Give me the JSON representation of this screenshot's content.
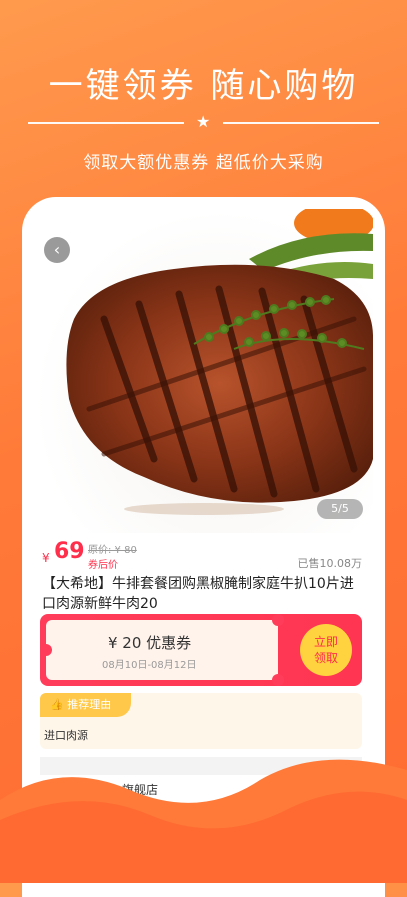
{
  "promo": {
    "headline": "一键领券 随心购物",
    "subhead": "领取大额优惠券 超低价大采购"
  },
  "product": {
    "image_icon": "steak-photo",
    "page_indicator": "5/5",
    "currency": "¥",
    "price": "69",
    "original_price": "原价: ¥ 80",
    "after_coupon_label": "券后价",
    "sold": "已售10.08万",
    "title": "【大希地】牛排套餐团购黑椒腌制家庭牛扒10片进口肉源新鲜牛肉20"
  },
  "coupon": {
    "amount": "¥ 20 优惠券",
    "date_range": "08月10日-08月12日",
    "claim_label": "立即\n领取"
  },
  "reason": {
    "tag": "推荐理由",
    "text": "进口肉源"
  },
  "store": {
    "name": "旗舰店"
  },
  "colors": {
    "background": "#ff7a38",
    "accent_red": "#ff2e4a",
    "claim_yellow": "#ffd23f"
  }
}
